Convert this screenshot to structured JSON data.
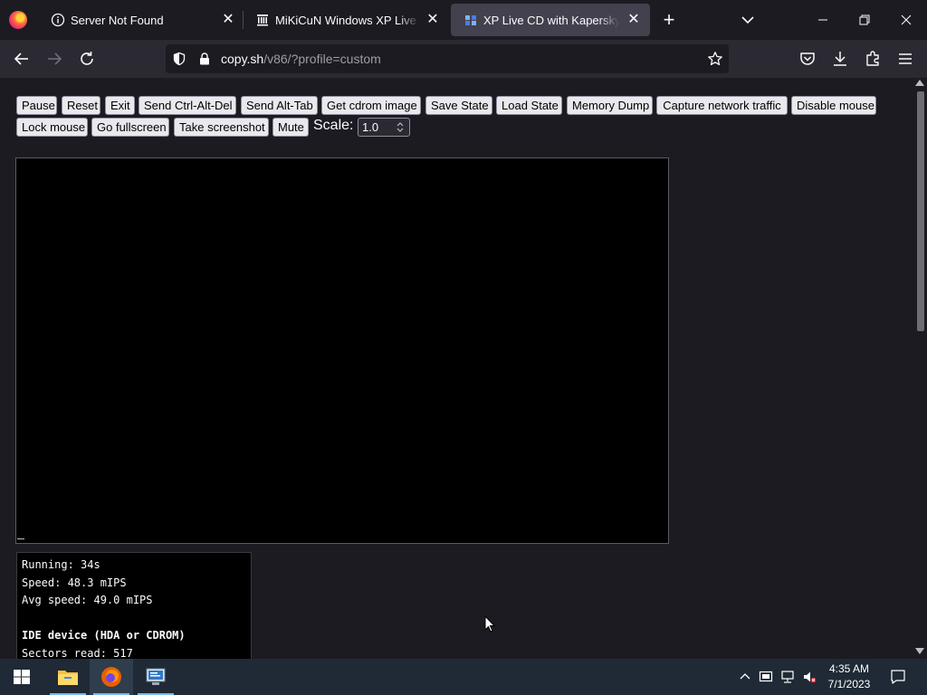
{
  "browser": {
    "tabs": [
      {
        "title": "Server Not Found",
        "active": false
      },
      {
        "title": "MiKiCuN Windows XP Live CD with",
        "active": false
      },
      {
        "title": "XP Live CD with Kapersky.iso - V",
        "active": true
      }
    ],
    "url": {
      "host": "copy.sh",
      "path": "/v86/?profile=custom"
    }
  },
  "toolbar": {
    "buttons": [
      "Pause",
      "Reset",
      "Exit",
      "Send Ctrl-Alt-Del",
      "Send Alt-Tab",
      "Get cdrom image",
      "Save State",
      "Load State",
      "Memory Dump",
      "Capture network traffic",
      "Disable mouse",
      "Lock mouse",
      "Go fullscreen",
      "Take screenshot",
      "Mute"
    ],
    "scale_label": "Scale:",
    "scale_value": "1.0"
  },
  "emulator": {
    "screen_background": "#000000",
    "stats": {
      "running": "Running: 34s",
      "speed": "Speed: 48.3 mIPS",
      "avg_speed": "Avg speed: 49.0 mIPS",
      "ide_heading": "IDE device (HDA or CDROM)",
      "sectors_read": "Sectors read: 517"
    }
  },
  "taskbar": {
    "apps": [
      "windows-start-icon",
      "file-explorer-icon",
      "firefox-icon",
      "remote-desktop-icon"
    ],
    "time": "4:35 AM",
    "date": "7/1/2023"
  },
  "colors": {
    "tab_bar": "#1c1b22",
    "nav_bar": "#2b2a33",
    "active_tab": "#42414d",
    "taskbar": "#1f2a36",
    "accent": "#76b9ed"
  }
}
